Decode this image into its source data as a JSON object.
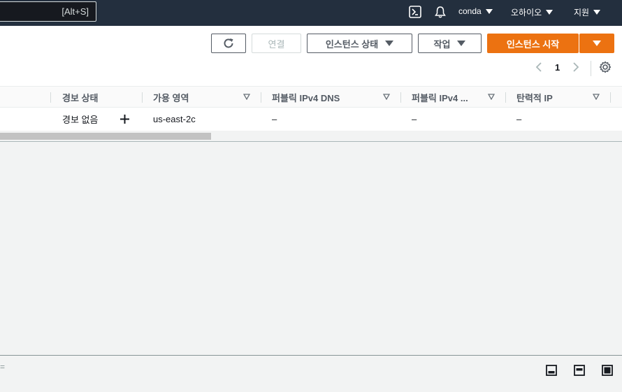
{
  "topnav": {
    "search_shortcut": "[Alt+S]",
    "account": "conda",
    "region": "오하이오",
    "support": "지원",
    "icons": [
      "cloudshell-icon",
      "bell-icon"
    ]
  },
  "toolbar": {
    "connect_label": "연결",
    "instance_state_label": "인스턴스 상태",
    "actions_label": "작업",
    "launch_label": "인스턴스 시작",
    "accent_color": "#ec7211"
  },
  "pagination": {
    "current_page": "1"
  },
  "table": {
    "columns": [
      "경보 상태",
      "가용 영역",
      "퍼블릭 IPv4 DNS",
      "퍼블릭 IPv4 ...",
      "탄력적 IP"
    ],
    "rows": [
      {
        "alarm": "경보 없음",
        "az": "us-east-2c",
        "dns": "–",
        "ipv4": "–",
        "eip": "–"
      }
    ]
  },
  "bottom": {
    "handle_glyph": "="
  }
}
